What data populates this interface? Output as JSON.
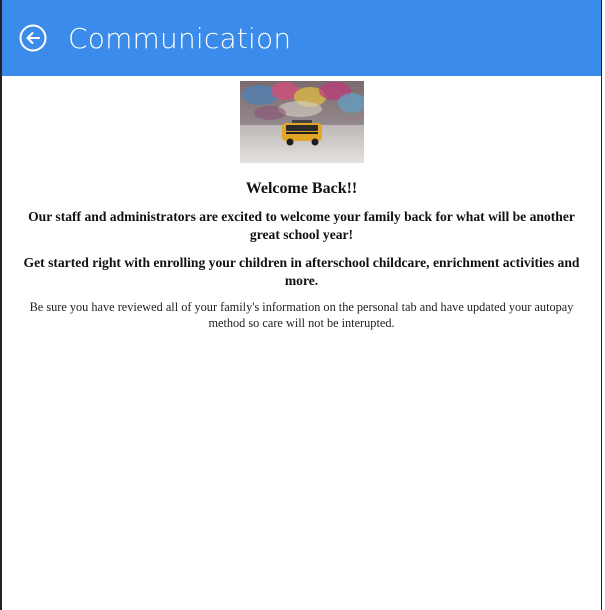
{
  "header": {
    "title": "Communication",
    "back_icon": "arrow-left-circle-icon",
    "bg_color": "#3b8beb"
  },
  "content": {
    "image_icon": "toy-school-bus-image",
    "welcome": "Welcome Back!!",
    "paragraph1": "Our staff and administrators are excited to welcome your family back for what will be another great school year!",
    "paragraph2": "Get started right with enrolling your children in afterschool childcare, enrichment activities and more.",
    "paragraph3": "Be sure you have reviewed all of your family's  information on the personal tab and have updated your autopay method so care will not be interupted."
  }
}
